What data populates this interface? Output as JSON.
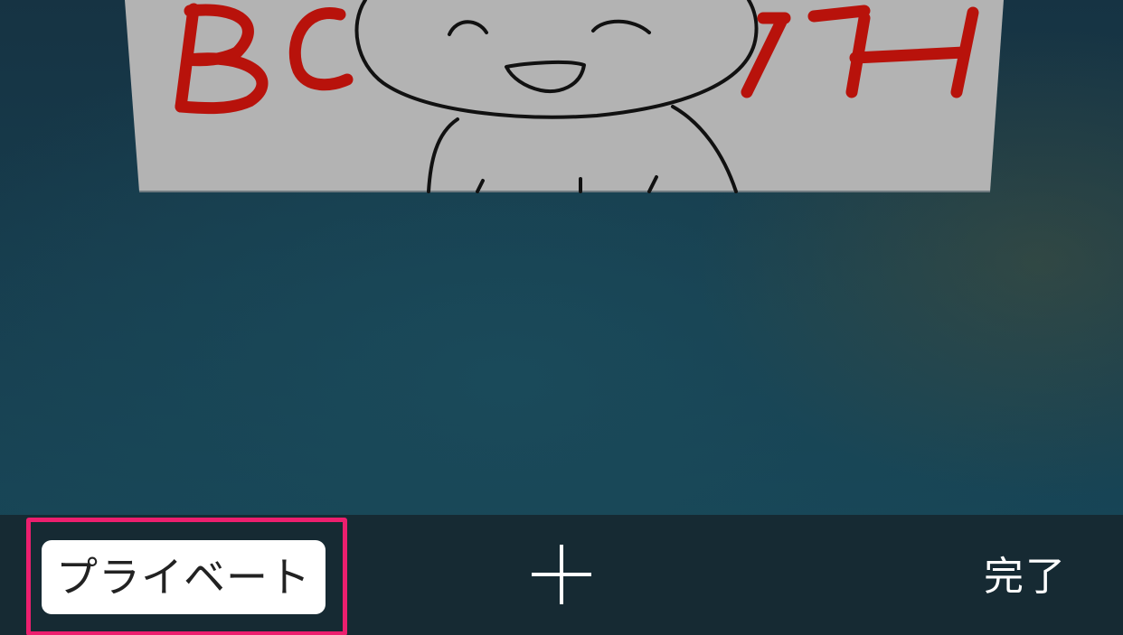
{
  "tab_card": {
    "image_title_text": "BOOTH"
  },
  "toolbar": {
    "private_label": "プライベート",
    "new_tab_icon": "plus-icon",
    "done_label": "完了"
  },
  "colors": {
    "toolbar_bg": "#162a33",
    "highlight": "#ec1f6e",
    "logo_red": "#c0140c",
    "card_bg": "#b3b3b3"
  }
}
